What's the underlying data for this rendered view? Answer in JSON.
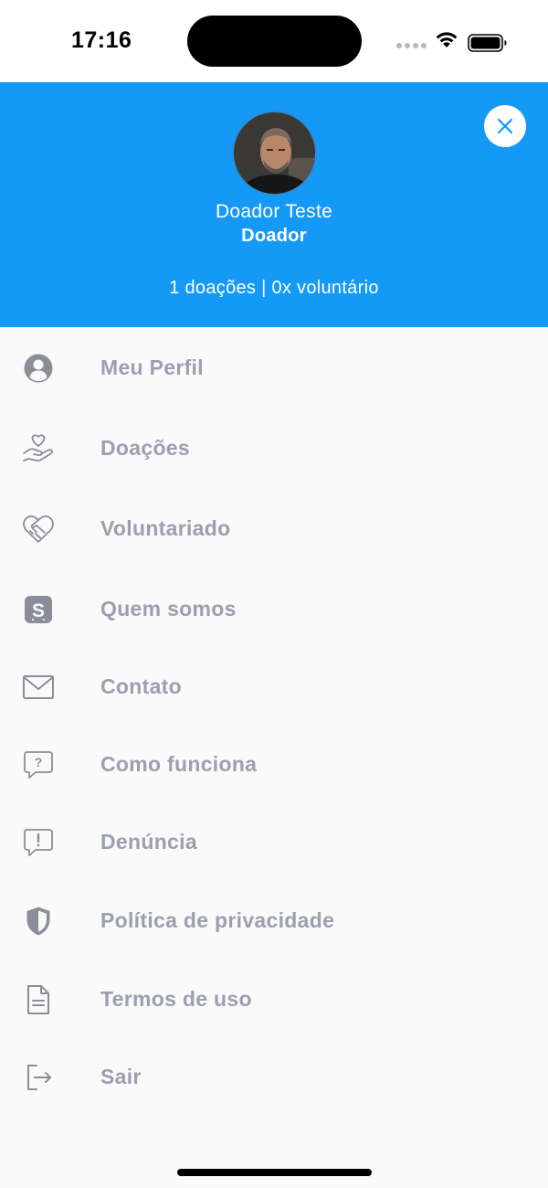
{
  "status_bar": {
    "time": "17:16"
  },
  "header": {
    "user_name": "Doador Teste",
    "user_role": "Doador",
    "stats": "1 doações | 0x voluntário",
    "background_color": "#1599f6"
  },
  "menu": {
    "items": [
      {
        "label": "Meu Perfil",
        "icon": "user-circle-icon"
      },
      {
        "label": "Doações",
        "icon": "hand-heart-icon"
      },
      {
        "label": "Voluntariado",
        "icon": "handshake-heart-icon"
      },
      {
        "label": "Quem somos",
        "icon": "brand-s-icon"
      },
      {
        "label": "Contato",
        "icon": "envelope-icon"
      },
      {
        "label": "Como funciona",
        "icon": "question-bubble-icon"
      },
      {
        "label": "Denúncia",
        "icon": "alert-bubble-icon"
      },
      {
        "label": "Política de privacidade",
        "icon": "shield-icon"
      },
      {
        "label": "Termos de uso",
        "icon": "document-icon"
      },
      {
        "label": "Sair",
        "icon": "logout-icon"
      }
    ],
    "label_color": "#9c9fae"
  }
}
